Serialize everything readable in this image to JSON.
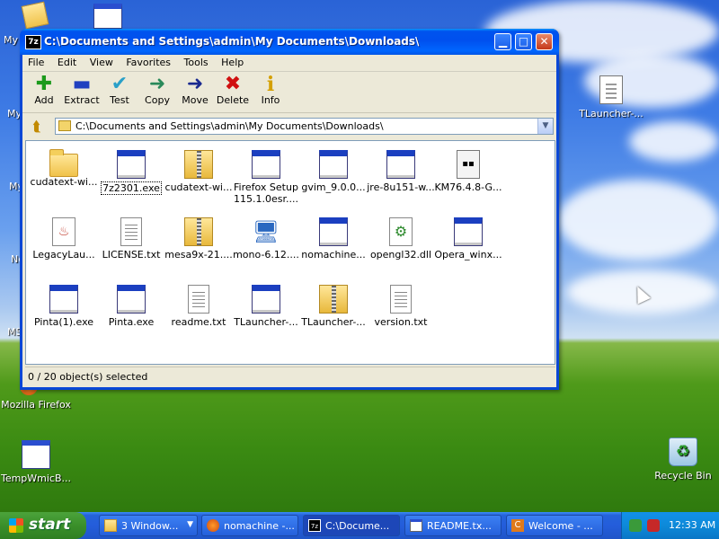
{
  "window": {
    "title": "C:\\Documents and Settings\\admin\\My Documents\\Downloads\\",
    "app_icon": "7z",
    "controls": [
      "minimize-icon",
      "maximize-icon",
      "close-icon"
    ]
  },
  "menu": [
    "File",
    "Edit",
    "View",
    "Favorites",
    "Tools",
    "Help"
  ],
  "toolbar": [
    {
      "label": "Add",
      "icon": "plus-icon",
      "glyph": "✚",
      "color": "#1c9a1c"
    },
    {
      "label": "Extract",
      "icon": "minus-icon",
      "glyph": "▬",
      "color": "#2040c0"
    },
    {
      "label": "Test",
      "icon": "check-icon",
      "glyph": "✔",
      "color": "#2aa0c8"
    },
    {
      "label": "Copy",
      "icon": "copy-arrow-icon",
      "glyph": "➜",
      "color": "#2a8a5a"
    },
    {
      "label": "Move",
      "icon": "move-arrow-icon",
      "glyph": "➜",
      "color": "#1a2a90"
    },
    {
      "label": "Delete",
      "icon": "delete-x-icon",
      "glyph": "✖",
      "color": "#d01010"
    },
    {
      "label": "Info",
      "icon": "info-icon",
      "glyph": "i",
      "color": "#d4a000"
    }
  ],
  "address": {
    "path": "C:\\Documents and Settings\\admin\\My Documents\\Downloads\\"
  },
  "files": [
    {
      "name": "cudatext-wi...",
      "type": "folder"
    },
    {
      "name": "7z2301.exe",
      "type": "exe",
      "focused": true
    },
    {
      "name": "cudatext-wi...",
      "type": "zip"
    },
    {
      "name": "Firefox Setup",
      "name2": "115.1.0esr....",
      "type": "exe"
    },
    {
      "name": "gvim_9.0.0...",
      "type": "exe"
    },
    {
      "name": "jre-8u151-w...",
      "type": "exe"
    },
    {
      "name": "KM76.4.8-G...",
      "type": "km"
    },
    {
      "name": "LegacyLau...",
      "type": "java"
    },
    {
      "name": "LICENSE.txt",
      "type": "txt"
    },
    {
      "name": "mesa9x-21....",
      "type": "zip"
    },
    {
      "name": "mono-6.12....",
      "type": "mono"
    },
    {
      "name": "nomachine...",
      "type": "exe"
    },
    {
      "name": "opengl32.dll",
      "type": "dll"
    },
    {
      "name": "Opera_winx...",
      "type": "exe"
    },
    {
      "name": "Pinta(1).exe",
      "type": "exe"
    },
    {
      "name": "Pinta.exe",
      "type": "exe"
    },
    {
      "name": "readme.txt",
      "type": "txt"
    },
    {
      "name": "TLauncher-...",
      "type": "exe"
    },
    {
      "name": "TLauncher-...",
      "type": "zip"
    },
    {
      "name": "version.txt",
      "type": "txt"
    }
  ],
  "status": "0 / 20 object(s) selected",
  "desktop": {
    "icons": [
      {
        "label": "Mozilla Firefox",
        "icon": "firefox-icon"
      },
      {
        "label": "TempWmicB...",
        "icon": "gear-file-icon"
      },
      {
        "label": "TLauncher-...",
        "icon": "java-file-icon"
      },
      {
        "label": "Recycle Bin",
        "icon": "recycle-bin-icon"
      }
    ],
    "edge_labels": [
      "My",
      "My",
      "My",
      "Ne",
      "MS"
    ]
  },
  "taskbar": {
    "start_label": "start",
    "tasks": [
      {
        "label": "3 Window...",
        "icon": "folder-icon"
      },
      {
        "label": "nomachine -...",
        "icon": "firefox-icon"
      },
      {
        "label": "C:\\Docume...",
        "icon": "7zip-icon",
        "active": true
      },
      {
        "label": "README.tx...",
        "icon": "notepad-icon"
      },
      {
        "label": "Welcome - ...",
        "icon": "cudatext-icon"
      }
    ],
    "clock": "12:33 AM"
  }
}
